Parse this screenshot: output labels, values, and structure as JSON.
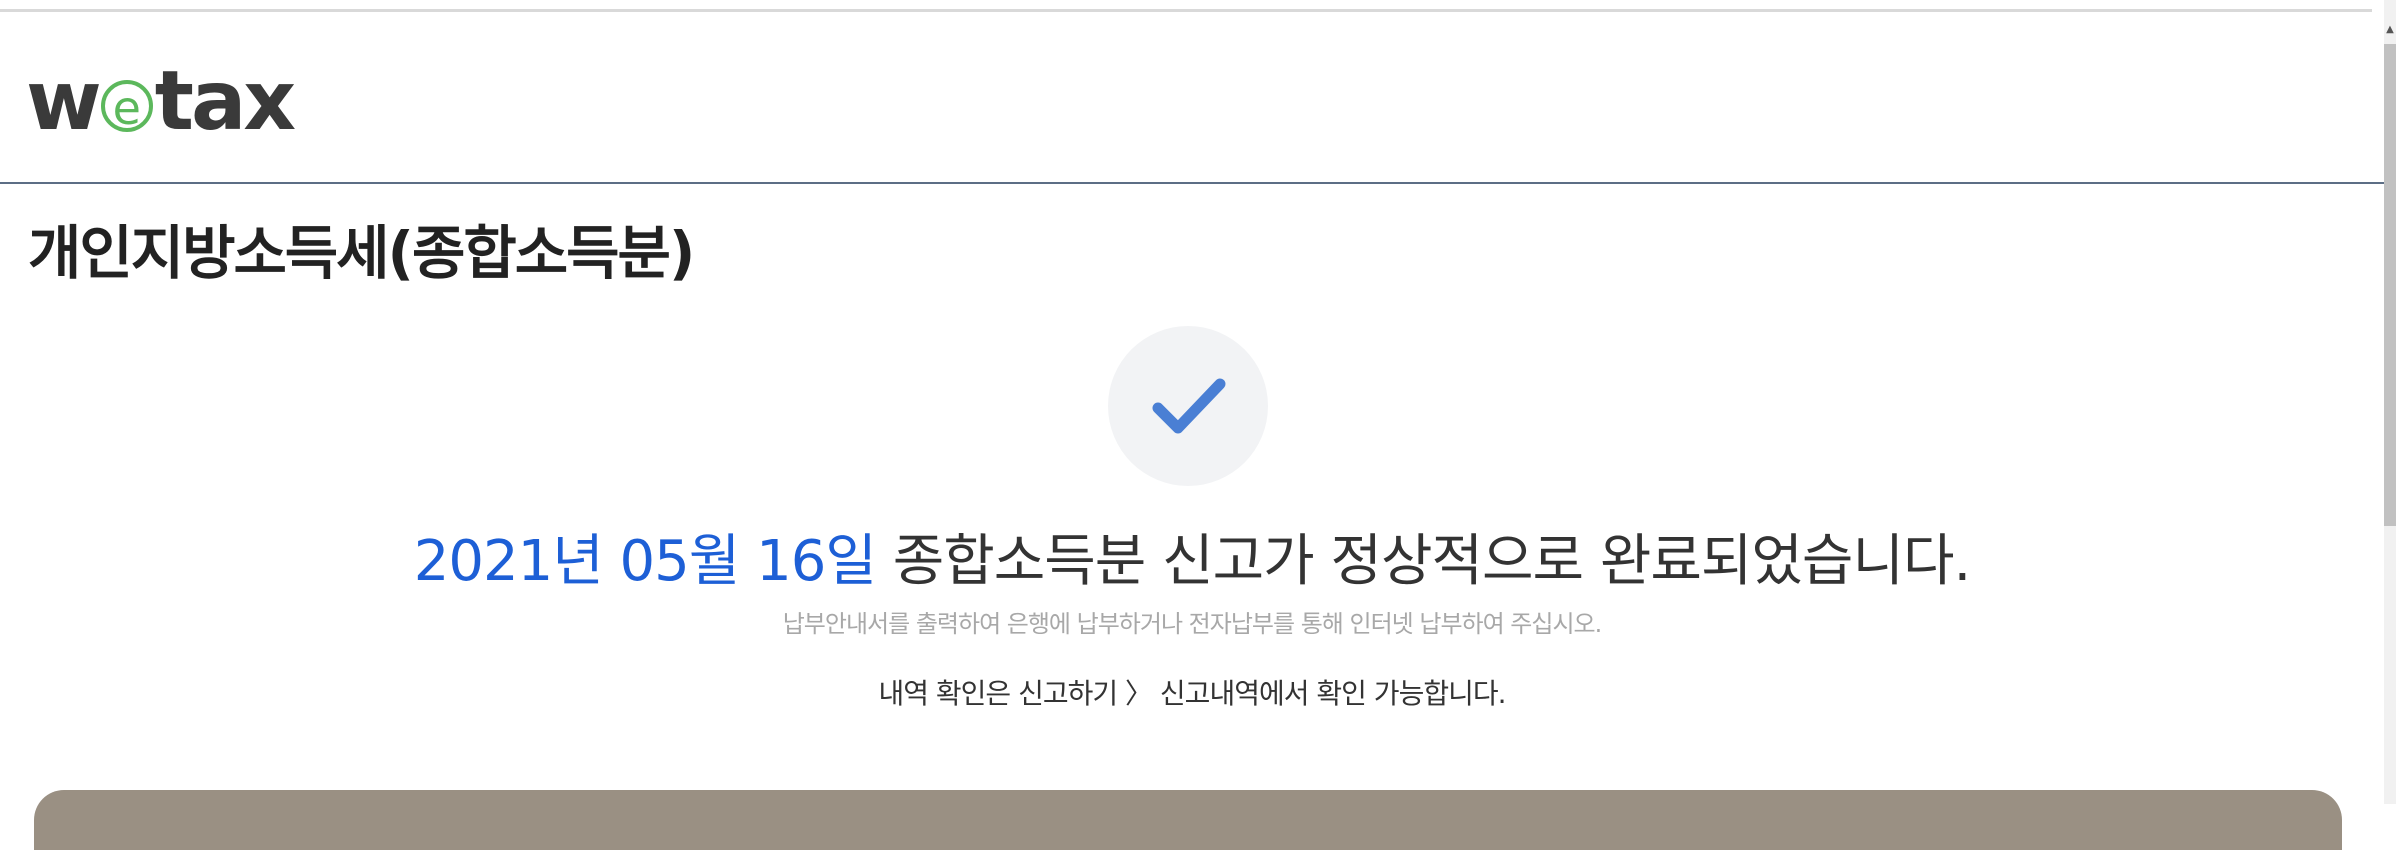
{
  "header": {
    "logo_text_left": "w",
    "logo_text_e": "e",
    "logo_text_right": "tax"
  },
  "page": {
    "title": "개인지방소득세(종합소득분)"
  },
  "result": {
    "check_icon": "checkmark-icon",
    "date_text": "2021년 05월 16일",
    "message_text": " 종합소득분 신고가 정상적으로 완료되었습니다.",
    "sub_message": "납부안내서를 출력하여 은행에 납부하거나 전자납부를 통해 인터넷 납부하여 주십시오.",
    "info_message": "내역 확인은 신고하기 〉 신고내역에서 확인 가능합니다."
  },
  "colors": {
    "date_accent": "#1d5fd6",
    "logo_green": "#5cb85c",
    "check_blue": "#4a7fd4",
    "panel": "#9a9083"
  }
}
